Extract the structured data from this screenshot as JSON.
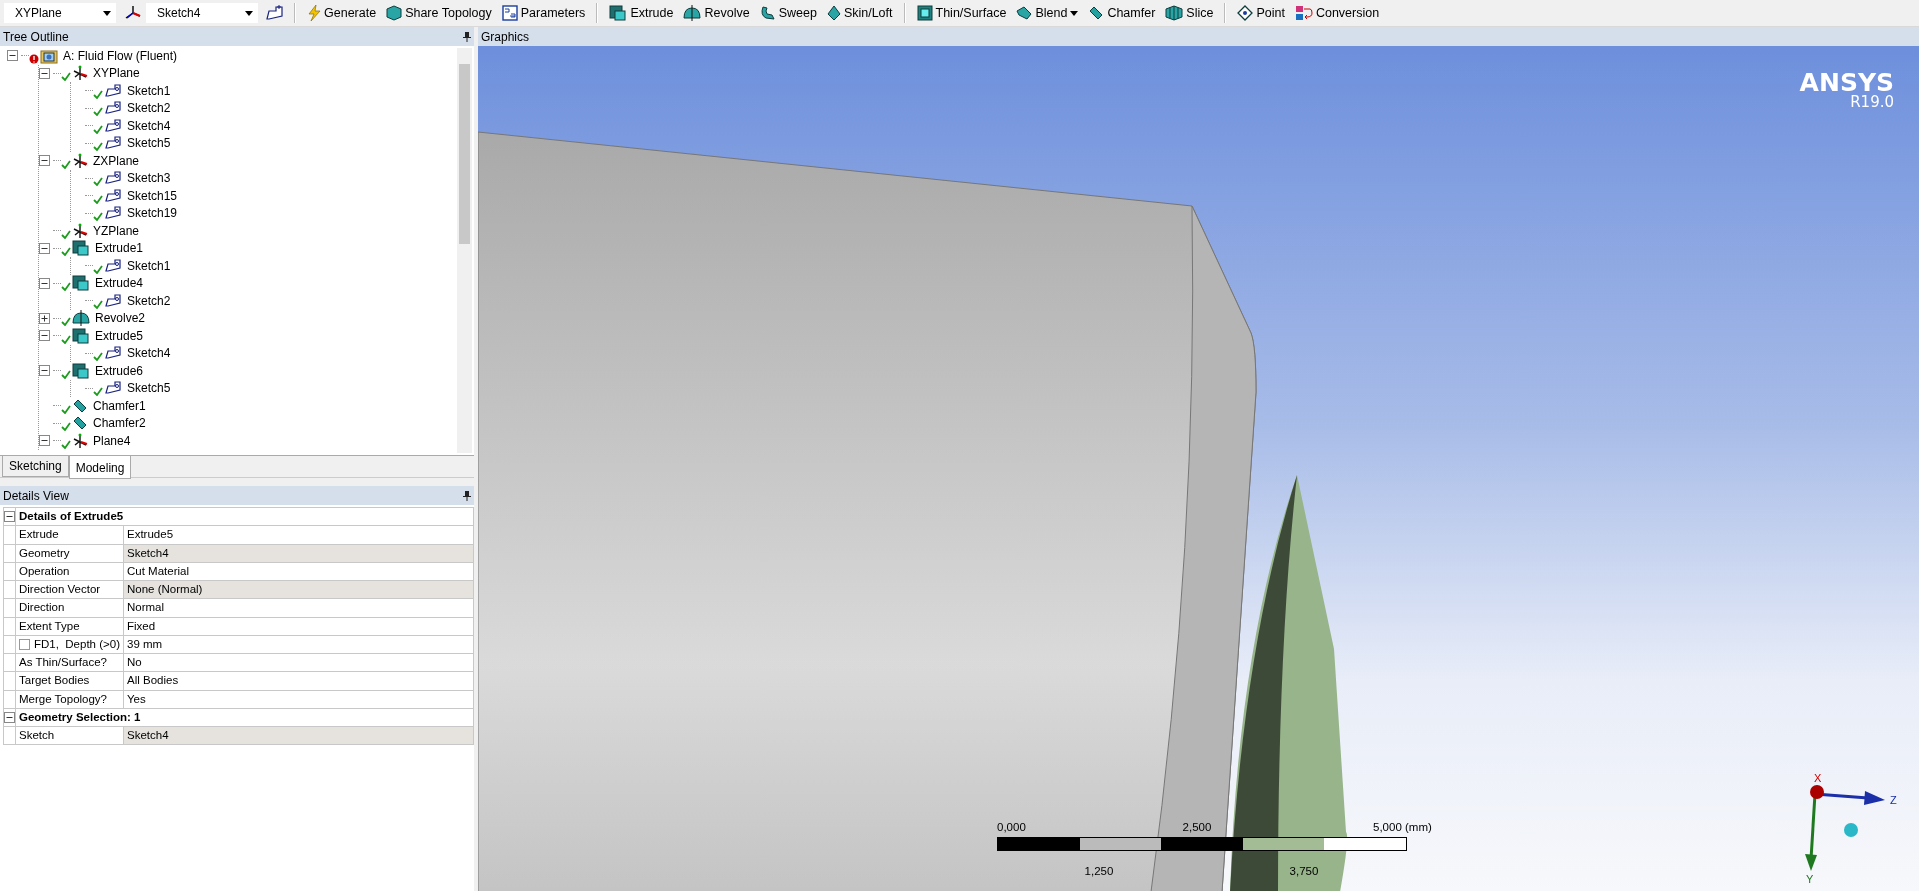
{
  "toolbar": {
    "groups": [
      [
        {
          "kind": "dropdown",
          "value": "XYPlane"
        },
        {
          "kind": "icon"
        },
        {
          "kind": "dropdown",
          "value": "Sketch4"
        },
        {
          "kind": "icon"
        }
      ],
      [
        {
          "kind": "button",
          "label": "Generate"
        },
        {
          "kind": "button",
          "label": "Share Topology"
        },
        {
          "kind": "button",
          "label": "Parameters"
        }
      ],
      [
        {
          "kind": "button",
          "label": "Extrude"
        },
        {
          "kind": "button",
          "label": "Revolve"
        },
        {
          "kind": "button",
          "label": "Sweep"
        },
        {
          "kind": "button",
          "label": "Skin/Loft"
        }
      ],
      [
        {
          "kind": "button",
          "label": "Thin/Surface"
        },
        {
          "kind": "button",
          "label": "Blend",
          "menu": true
        },
        {
          "kind": "button",
          "label": "Chamfer"
        },
        {
          "kind": "button",
          "label": "Slice"
        }
      ],
      [
        {
          "kind": "button",
          "label": "Point"
        },
        {
          "kind": "button",
          "label": "Conversion"
        }
      ]
    ]
  },
  "tree": {
    "title": "Tree Outline",
    "items": [
      {
        "label": "A: Fluid Flow (Fluent)",
        "kind": "root",
        "valid": false,
        "expanded": true,
        "children": [
          {
            "label": "XYPlane",
            "kind": "plane",
            "valid": true,
            "expanded": true,
            "children": [
              {
                "label": "Sketch1",
                "kind": "sketch",
                "valid": true
              },
              {
                "label": "Sketch2",
                "kind": "sketch",
                "valid": true
              },
              {
                "label": "Sketch4",
                "kind": "sketch",
                "valid": true
              },
              {
                "label": "Sketch5",
                "kind": "sketch",
                "valid": true
              }
            ]
          },
          {
            "label": "ZXPlane",
            "kind": "plane",
            "valid": true,
            "expanded": true,
            "children": [
              {
                "label": "Sketch3",
                "kind": "sketch",
                "valid": true
              },
              {
                "label": "Sketch15",
                "kind": "sketch",
                "valid": true
              },
              {
                "label": "Sketch19",
                "kind": "sketch",
                "valid": true
              }
            ]
          },
          {
            "label": "YZPlane",
            "kind": "plane",
            "valid": true
          },
          {
            "label": "Extrude1",
            "kind": "extrude",
            "valid": true,
            "expanded": true,
            "children": [
              {
                "label": "Sketch1",
                "kind": "sketch",
                "valid": true
              }
            ]
          },
          {
            "label": "Extrude4",
            "kind": "extrude",
            "valid": true,
            "expanded": true,
            "children": [
              {
                "label": "Sketch2",
                "kind": "sketch",
                "valid": true
              }
            ]
          },
          {
            "label": "Revolve2",
            "kind": "revolve",
            "valid": true,
            "expanded": false
          },
          {
            "label": "Extrude5",
            "kind": "extrude",
            "valid": true,
            "expanded": true,
            "children": [
              {
                "label": "Sketch4",
                "kind": "sketch",
                "valid": true
              }
            ]
          },
          {
            "label": "Extrude6",
            "kind": "extrude",
            "valid": true,
            "expanded": true,
            "children": [
              {
                "label": "Sketch5",
                "kind": "sketch",
                "valid": true
              }
            ]
          },
          {
            "label": "Chamfer1",
            "kind": "chamfer",
            "valid": true
          },
          {
            "label": "Chamfer2",
            "kind": "chamfer",
            "valid": true
          },
          {
            "label": "Plane4",
            "kind": "plane",
            "valid": true,
            "expanded": true
          }
        ]
      }
    ]
  },
  "tree_tabs": [
    {
      "label": "Sketching",
      "selected": false
    },
    {
      "label": "Modeling",
      "selected": true
    }
  ],
  "details": {
    "title": "Details View",
    "groups": [
      {
        "title": "Details of Extrude5",
        "expanded": true,
        "rows": [
          {
            "label": "Extrude",
            "value": "Extrude5",
            "shaded": false
          },
          {
            "label": "Geometry",
            "value": "Sketch4",
            "shaded": true
          },
          {
            "label": "Operation",
            "value": "Cut Material",
            "shaded": false
          },
          {
            "label": "Direction Vector",
            "value": "None (Normal)",
            "shaded": true
          },
          {
            "label": "Direction",
            "value": "Normal",
            "shaded": false
          },
          {
            "label": "Extent Type",
            "value": "Fixed",
            "shaded": false
          },
          {
            "label": "FD1,  Depth (>0)",
            "value": "39 mm",
            "shaded": false,
            "checked": false
          },
          {
            "label": "As Thin/Surface?",
            "value": "No",
            "shaded": false
          },
          {
            "label": "Target Bodies",
            "value": "All Bodies",
            "shaded": false
          },
          {
            "label": "Merge Topology?",
            "value": "Yes",
            "shaded": false
          }
        ]
      },
      {
        "title": "Geometry Selection: 1",
        "expanded": true,
        "rows": [
          {
            "label": "Sketch",
            "value": "Sketch4",
            "shaded": true
          }
        ]
      }
    ]
  },
  "graphics": {
    "title": "Graphics",
    "logo": {
      "brand": "ANSYS",
      "version": "R19.0"
    },
    "scale_bar": {
      "top_labels": [
        "0,000",
        "2,500",
        "5,000"
      ],
      "unit": "(mm)",
      "bottom_labels": [
        "1,250",
        "3,750"
      ]
    },
    "triad": {
      "x": "X",
      "y": "Y",
      "z": "Z"
    }
  }
}
